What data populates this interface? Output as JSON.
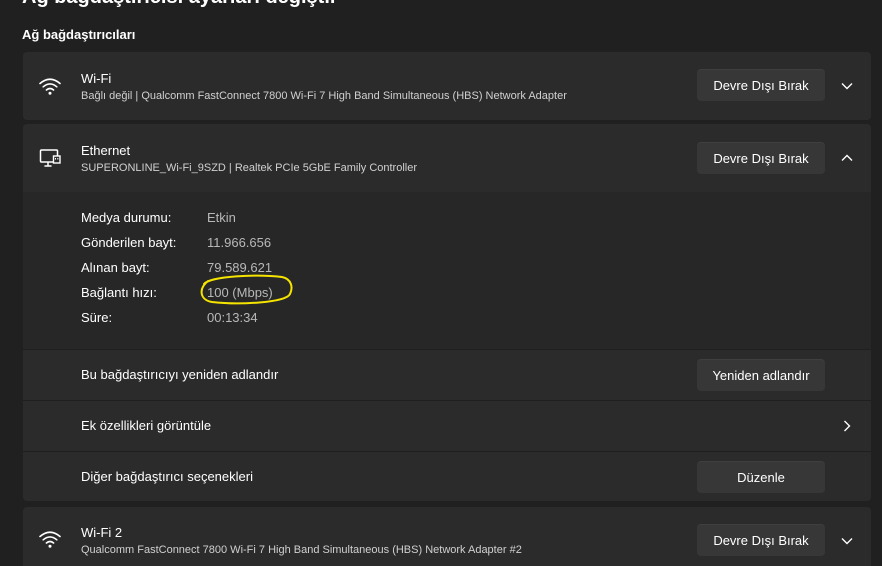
{
  "page": {
    "top_title_fragment": "Ağ bağdaştırıcısı ayarları değiştir",
    "section_title": "Ağ bağdaştırıcıları"
  },
  "adapters": {
    "wifi": {
      "name": "Wi-Fi",
      "subtitle": "Bağlı değil | Qualcomm FastConnect 7800 Wi-Fi 7 High Band Simultaneous (HBS) Network Adapter",
      "button": "Devre Dışı Bırak",
      "icon": "wifi-icon"
    },
    "ethernet": {
      "name": "Ethernet",
      "subtitle": "SUPERONLINE_Wi-Fi_9SZD | Realtek PCIe 5GbE Family Controller",
      "button": "Devre Dışı Bırak",
      "icon": "ethernet-monitor-icon",
      "details": [
        {
          "label": "Medya durumu:",
          "value": "Etkin"
        },
        {
          "label": "Gönderilen bayt:",
          "value": "11.966.656"
        },
        {
          "label": "Alınan bayt:",
          "value": "79.589.621"
        },
        {
          "label": "Bağlantı hızı:",
          "value": "100 (Mbps)"
        },
        {
          "label": "Süre:",
          "value": "00:13:34"
        }
      ],
      "rename": {
        "label": "Bu bağdaştırıcıyı yeniden adlandır",
        "button": "Yeniden adlandır"
      },
      "properties": {
        "label": "Ek özellikleri görüntüle"
      },
      "more_options": {
        "label": "Diğer bağdaştırıcı seçenekleri",
        "button": "Düzenle"
      }
    },
    "wifi2": {
      "name": "Wi-Fi 2",
      "subtitle": "Qualcomm FastConnect 7800 Wi-Fi 7 High Band Simultaneous (HBS) Network Adapter #2",
      "button": "Devre Dışı Bırak",
      "icon": "wifi-icon"
    }
  },
  "colors": {
    "background": "#202020",
    "card": "#2b2b2b",
    "button": "#373737",
    "annotation": "#f5e400"
  }
}
